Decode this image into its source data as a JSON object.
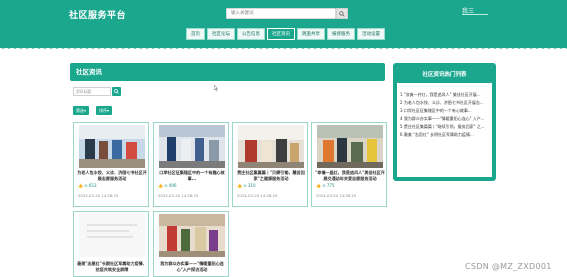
{
  "header": {
    "brand": "社区服务平台",
    "search_placeholder": "输入关键词",
    "user": "我三"
  },
  "nav": [
    {
      "label": "首页"
    },
    {
      "label": "社区论坛"
    },
    {
      "label": "公告信息"
    },
    {
      "label": "社区资讯"
    },
    {
      "label": "跳蚤共享"
    },
    {
      "label": "报修服务"
    },
    {
      "label": "活动设置"
    }
  ],
  "main": {
    "section_title": "社区资讯",
    "search_placeholder": "资讯标题",
    "filter_buttons": [
      "筛选▾",
      "排序▾"
    ]
  },
  "cards": [
    {
      "title": "为老人包水饺、义诊、济困七书社区开展志愿服务活动",
      "views": "653",
      "date": "2024-03-20 14:28:25"
    },
    {
      "title": "口岸社区征集辖区中的一个有趣心故事...",
      "views": "496",
      "date": "2024-03-20 14:28:25"
    },
    {
      "title": "贯庄社区集篇篇丨\"贝肆引锄，雕苦回家\"之健康服务活动",
      "views": "310",
      "date": "2024-03-20 14:28:25"
    },
    {
      "title": "\"幸福一届红，我是追风人\"美佳社区开展交通幼年关爱志愿服务活动",
      "views": "775",
      "date": "2024-03-20 14:28:25"
    },
    {
      "title": "最美\"志愿红\"长期社区军属助力疫情、抗疫共筑安全屏障",
      "views": "",
      "date": ""
    },
    {
      "title": "我为群众办实事——\"情暖重阳心连心\"入户探访活动",
      "views": "",
      "date": ""
    }
  ],
  "sidebar": {
    "title": "社区资讯热门列表",
    "items": [
      "1  \"凉爽一井红，我是追风人\" 美佳社区开展...",
      "2  为老人包水饺、义诊、济困七书社区开展志...",
      "3  口岸社区征集辖区中的一个有心故事...",
      "4  我为群众办实事——\"情暖重阳心连心\" 入户...",
      "5  贯庄社区集篇篇丨\"继续引领，服务回家\" 之...",
      "6  最美 \"志愿红\" 长明社区军属助力疫情..."
    ]
  },
  "watermark": "CSDN @MZ_ZXD001",
  "colors": {
    "primary": "#1aa78e",
    "border": "#9ad7c9"
  }
}
